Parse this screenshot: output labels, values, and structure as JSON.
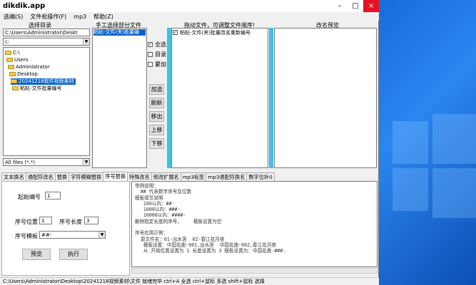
{
  "app_title": "dikdik.app",
  "window_controls": {
    "minimize": "–",
    "maximize": "□",
    "close": "×"
  },
  "menu": [
    "选编(S)",
    "文件批操作(F)",
    "mp3",
    "帮助(Z)"
  ],
  "left": {
    "label": "选择目录",
    "path": "C:\\Users\\Administrator\\Deskt",
    "drive": "c:",
    "tree": [
      "C:\\",
      "Users",
      "Administrator",
      "Desktop",
      "20241218软件视频素材",
      "粘帖-文件批量编号"
    ],
    "filter": "All files (*.*)"
  },
  "manual": {
    "label": "手工选择部分文件",
    "items": [
      "粘帖-文件(夹)批量编"
    ]
  },
  "options": {
    "all": "全选",
    "dir": "目录",
    "add": "累加",
    "buttons": [
      "加选",
      "刷新",
      "移出",
      "上移",
      "下移"
    ]
  },
  "drag": {
    "label": "拖动文件，可调整文件顺序!",
    "items": [
      "粘帖-文件(夹)批量改名重新编号"
    ]
  },
  "preview": {
    "label": "改名预览"
  },
  "tabs": [
    "文本换名",
    "通配符改名",
    "替换",
    "字符模糊替换",
    "序号替换",
    "特殊改名",
    "修改扩展名",
    "mp3标签",
    "mp3通配符换名",
    "数字位补0"
  ],
  "form": {
    "start_label": "起始编号",
    "start_value": "1",
    "pos_label": "序号位置",
    "pos_value": "1",
    "len_label": "序号长度",
    "len_value": "3",
    "tpl_label": "序号模板",
    "tpl_value": "##-",
    "preview_btn": "预览",
    "exec_btn": "执行"
  },
  "help_lines": [
    "举例说明：",
    "  ## 代表数字序号及位数",
    "模板填写说明",
    "   100以内：##-",
    "   1000以内：###-",
    "   10000以内：####-",
    "删除指定长度的序号，    模板设置为空",
    "",
    "序号应用示例：",
    "  原文件名：01-出水莲  02-春江花月夜",
    "   模板设置：中国名曲-001,出水莲  中国名曲-002,春江花月夜",
    "   从 开始位置设置为 1 长度设置为 3 模板设置为：中国名曲-###."
  ],
  "status": "C:\\Users\\Administrator\\Desktop\\20241218视频素材\\文件    就绪完毕    ctrl+A 全选  ctrl+鼠标 多选  shift+鼠标 选择"
}
